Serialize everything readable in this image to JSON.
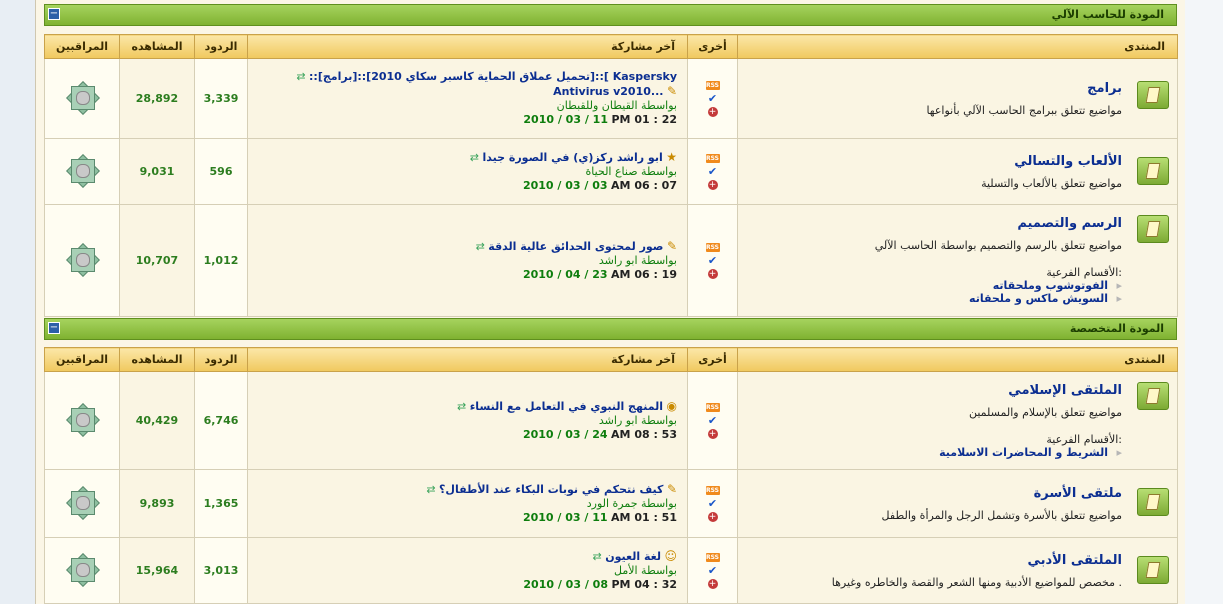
{
  "categories": [
    {
      "title": "المودة للحاسب الآلي",
      "columns": {
        "forum": "المنتدى",
        "misc": "أخرى",
        "last_post": "آخر مشاركة",
        "replies": "الردود",
        "views": "المشاهده",
        "moderators": "المراقبين"
      },
      "forums": [
        {
          "name": "برامج",
          "desc": "مواضيع تتعلق ببرامج الحاسب الآلي بأنواعها",
          "subforums_label": "",
          "subforums": [],
          "last_title": "::[برامج]::[تحميل عملاق الحماية كاسبر سكاي 2010]::[ Kaspersky Antivirus v2010...",
          "by_prefix": "بواسطة",
          "by_user": "القيطان وللقبطان",
          "date": "2010 / 03 / 11",
          "time": "PM 01 : 22",
          "replies": "3,339",
          "views": "28,892"
        },
        {
          "name": "الألعاب والتسالي",
          "desc": "مواضيع تتعلق بالألعاب والتسلية",
          "subforums_label": "",
          "subforums": [],
          "last_title": "ابو راشد ركز(ي) في الصورة جيدا",
          "by_prefix": "بواسطة",
          "by_user": "صناع الحياة",
          "date": "2010 / 03 / 03",
          "time": "AM 06 : 07",
          "replies": "596",
          "views": "9,031"
        },
        {
          "name": "الرسم والتصميم",
          "desc": "مواضيع تتعلق بالرسم والتصميم بواسطة الحاسب الآلي",
          "subforums_label": "الأقسام الفرعية:",
          "subforums": [
            "الفوتوشوب وملحقاته",
            "السويش ماكس و ملحقاته"
          ],
          "last_title": "صور لمحتوى الحدائق عالية الدقة",
          "by_prefix": "بواسطة",
          "by_user": "ابو راشد",
          "date": "2010 / 04 / 23",
          "time": "AM 06 : 19",
          "replies": "1,012",
          "views": "10,707"
        }
      ]
    },
    {
      "title": "المودة المتخصصة",
      "columns": {
        "forum": "المنتدى",
        "misc": "أخرى",
        "last_post": "آخر مشاركة",
        "replies": "الردود",
        "views": "المشاهده",
        "moderators": "المراقبين"
      },
      "forums": [
        {
          "name": "الملتقى الإسلامي",
          "desc": "مواضيع تتعلق بالإسلام والمسلمين",
          "subforums_label": "الأقسام الفرعية:",
          "subforums": [
            "الشريط و المحاضرات الاسلامية"
          ],
          "last_title": "المنهج النبوي في التعامل مع النساء",
          "by_prefix": "بواسطة",
          "by_user": "ابو راشد",
          "date": "2010 / 03 / 24",
          "time": "AM 08 : 53",
          "replies": "6,746",
          "views": "40,429"
        },
        {
          "name": "ملتقى الأسرة",
          "desc": "مواضيع تتعلق بالأسرة وتشمل الرجل والمرأة والطفل",
          "subforums_label": "",
          "subforums": [],
          "last_title": "كيف نتحكم في نوبات البكاء عند الأطفال؟",
          "by_prefix": "بواسطة",
          "by_user": "جمرة الورد",
          "date": "2010 / 03 / 11",
          "time": "AM 01 : 51",
          "replies": "1,365",
          "views": "9,893"
        },
        {
          "name": "الملتقى الأدبي",
          "desc": "مخصص للمواضيع الأدبية ومنها الشعر والقصة والخاطره وغيرها .",
          "subforums_label": "",
          "subforums": [],
          "last_title": "لغة العيون",
          "by_prefix": "بواسطة",
          "by_user": "الأمل",
          "date": "2010 / 03 / 08",
          "time": "PM 04 : 32",
          "replies": "3,013",
          "views": "15,964"
        }
      ]
    }
  ],
  "icons": {
    "rss": "RSS",
    "collapse": "−"
  }
}
